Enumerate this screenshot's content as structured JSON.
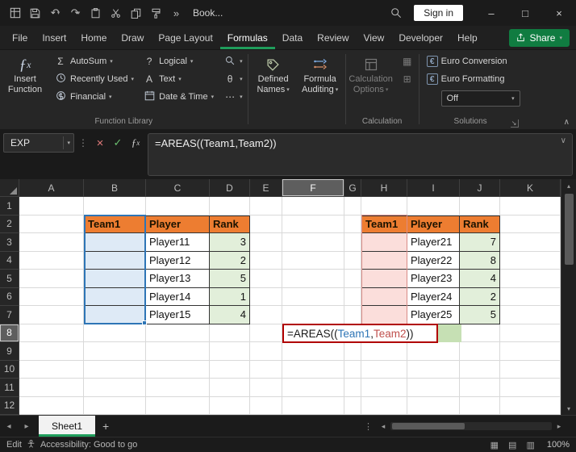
{
  "title_bar": {
    "doc_title": "Book...",
    "sign_in_label": "Sign in"
  },
  "tabs": {
    "items": [
      "File",
      "Insert",
      "Home",
      "Draw",
      "Page Layout",
      "Formulas",
      "Data",
      "Review",
      "View",
      "Developer",
      "Help"
    ],
    "active": "Formulas",
    "share_label": "Share"
  },
  "ribbon": {
    "insert_function_line1": "Insert",
    "insert_function_line2": "Function",
    "autosum": "AutoSum",
    "recently_used": "Recently Used",
    "financial": "Financial",
    "logical": "Logical",
    "text": "Text",
    "date_time": "Date & Time",
    "function_library_label": "Function Library",
    "defined_names_line1": "Defined",
    "defined_names_line2": "Names",
    "formula_auditing_line1": "Formula",
    "formula_auditing_line2": "Auditing",
    "calculation_options_line1": "Calculation",
    "calculation_options_line2": "Options",
    "calculation_label": "Calculation",
    "euro_conversion": "Euro Conversion",
    "euro_formatting": "Euro Formatting",
    "off_value": "Off",
    "solutions_label": "Solutions"
  },
  "formula_bar": {
    "name_box": "EXP",
    "formula": "=AREAS((Team1,Team2))"
  },
  "grid": {
    "col_headers": [
      "A",
      "B",
      "C",
      "D",
      "E",
      "F",
      "G",
      "H",
      "I",
      "J",
      "K"
    ],
    "row_headers": [
      "1",
      "2",
      "3",
      "4",
      "5",
      "6",
      "7",
      "8",
      "9",
      "10",
      "11",
      "12"
    ],
    "selected_col": "F",
    "selected_row": "8",
    "cells": {
      "B2": {
        "v": "Team1",
        "c": "hdr bt bl"
      },
      "C2": {
        "v": "Player",
        "c": "hdr bt"
      },
      "D2": {
        "v": "Rank",
        "c": "hdr bt"
      },
      "B3": {
        "c": "tc blue bl"
      },
      "B4": {
        "c": "tc blue bl"
      },
      "B5": {
        "c": "tc blue bl"
      },
      "B6": {
        "c": "tc blue bl"
      },
      "B7": {
        "c": "tc blue bl"
      },
      "C3": {
        "v": "Player11",
        "c": "tc"
      },
      "C4": {
        "v": "Player12",
        "c": "tc"
      },
      "C5": {
        "v": "Player13",
        "c": "tc"
      },
      "C6": {
        "v": "Player14",
        "c": "tc"
      },
      "C7": {
        "v": "Player15",
        "c": "tc"
      },
      "D3": {
        "v": "3",
        "c": "tc green"
      },
      "D4": {
        "v": "2",
        "c": "tc green"
      },
      "D5": {
        "v": "5",
        "c": "tc green"
      },
      "D6": {
        "v": "1",
        "c": "tc green"
      },
      "D7": {
        "v": "4",
        "c": "tc green"
      },
      "H2": {
        "v": "Team1",
        "c": "hdr bt bl"
      },
      "I2": {
        "v": "Player",
        "c": "hdr bt"
      },
      "J2": {
        "v": "Rank",
        "c": "hdr bt"
      },
      "H3": {
        "c": "tc pink bl"
      },
      "H4": {
        "c": "tc pink bl"
      },
      "H5": {
        "c": "tc pink bl"
      },
      "H6": {
        "c": "tc pink bl"
      },
      "H7": {
        "c": "tc pink bl"
      },
      "I3": {
        "v": "Player21",
        "c": "tc"
      },
      "I4": {
        "v": "Player22",
        "c": "tc"
      },
      "I5": {
        "v": "Player23",
        "c": "tc"
      },
      "I6": {
        "v": "Player24",
        "c": "tc"
      },
      "I7": {
        "v": "Player25",
        "c": "tc"
      },
      "J3": {
        "v": "7",
        "c": "tc green"
      },
      "J4": {
        "v": "8",
        "c": "tc green"
      },
      "J5": {
        "v": "4",
        "c": "tc green"
      },
      "J6": {
        "v": "2",
        "c": "tc green"
      },
      "J7": {
        "v": "5",
        "c": "tc green"
      }
    }
  },
  "formula_cell": {
    "segments": [
      {
        "t": "=AREAS((",
        "color": "#1a1a1a"
      },
      {
        "t": "Team1",
        "color": "#2E75B6"
      },
      {
        "t": ",",
        "color": "#1a1a1a"
      },
      {
        "t": "Team2",
        "color": "#C0504D"
      },
      {
        "t": "))",
        "color": "#1a1a1a"
      }
    ]
  },
  "sheet_bar": {
    "sheet_name": "Sheet1"
  },
  "status_bar": {
    "mode": "Edit",
    "accessibility": "Accessibility: Good to go",
    "zoom": "100%"
  },
  "colors": {
    "accent_green": "#1f9d5b",
    "share_green": "#107C41",
    "table_header_orange": "#ED7D31",
    "fill_blue": "#DEEAF6",
    "fill_green": "#E2EFDA",
    "fill_pink": "#FBDEDB",
    "range1_blue": "#2E75B6",
    "range2_red": "#C0504D",
    "edit_border_red": "#B00000"
  }
}
